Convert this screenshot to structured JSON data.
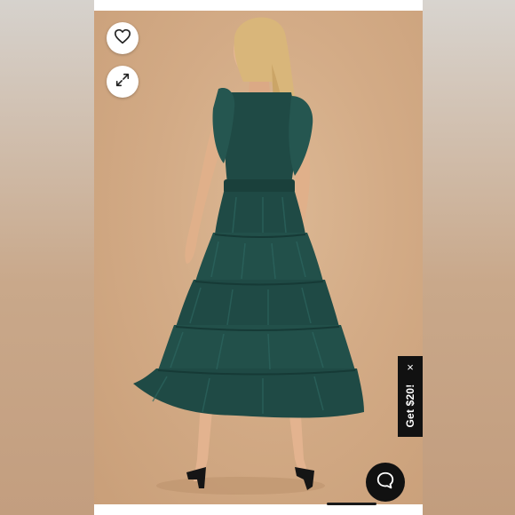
{
  "product_image": {
    "alt": "",
    "colors": {
      "background": "#d3ab86",
      "dress": "#1f4a45",
      "frame": "#ffffff"
    }
  },
  "actions": {
    "favorite_icon": "heart-icon",
    "expand_icon": "expand-icon"
  },
  "promo": {
    "label": "Get $20!",
    "close_glyph": "×"
  },
  "chat": {
    "icon": "chat-bubble-icon"
  }
}
